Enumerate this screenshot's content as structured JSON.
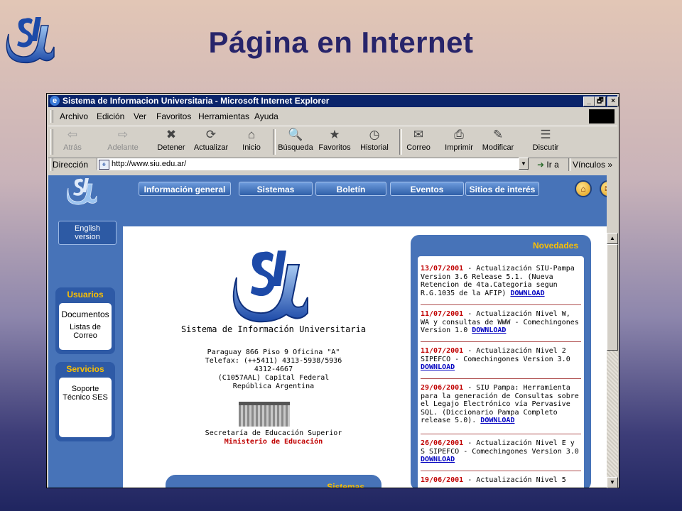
{
  "slide": {
    "title": "Página en Internet",
    "logo_text": "SIU"
  },
  "window": {
    "title": "Sistema de Informacion Universitaria - Microsoft Internet Explorer",
    "minimize": "_",
    "maximize": "🗗",
    "close": "×",
    "menu": [
      "Archivo",
      "Edición",
      "Ver",
      "Favoritos",
      "Herramientas",
      "Ayuda"
    ],
    "toolbar": [
      {
        "label": "Atrás",
        "icon": "arrow-left-icon",
        "glyph": "⇦"
      },
      {
        "label": "Adelante",
        "icon": "arrow-right-icon",
        "glyph": "⇨"
      },
      {
        "label": "Detener",
        "icon": "stop-icon",
        "glyph": "✖"
      },
      {
        "label": "Actualizar",
        "icon": "refresh-icon",
        "glyph": "⟳"
      },
      {
        "label": "Inicio",
        "icon": "home-icon",
        "glyph": "⌂"
      },
      {
        "label": "Búsqueda",
        "icon": "search-icon",
        "glyph": "🔍"
      },
      {
        "label": "Favoritos",
        "icon": "favorites-icon",
        "glyph": "★"
      },
      {
        "label": "Historial",
        "icon": "history-icon",
        "glyph": "◷"
      },
      {
        "label": "Correo",
        "icon": "mail-icon",
        "glyph": "✉"
      },
      {
        "label": "Imprimir",
        "icon": "print-icon",
        "glyph": "⎙"
      },
      {
        "label": "Modificar",
        "icon": "edit-icon",
        "glyph": "✎"
      },
      {
        "label": "Discutir",
        "icon": "discuss-icon",
        "glyph": "☰"
      }
    ],
    "address_label": "Dirección",
    "url": "http://www.siu.edu.ar/",
    "go_label": "Ir a",
    "links_label": "Vínculos"
  },
  "site": {
    "nav": [
      "Información general",
      "Sistemas",
      "Boletín",
      "Eventos",
      "Sitios de interés"
    ],
    "english_line1": "English",
    "english_line2": "version",
    "usuarios": {
      "header": "Usuarios",
      "items": [
        "Documentos",
        "Listas de",
        "Correo"
      ]
    },
    "servicios": {
      "header": "Servicios",
      "items": [
        "Soporte",
        "Técnico SES"
      ]
    },
    "center": {
      "name": "Sistema de Información Universitaria",
      "address": [
        "Paraguay 866 Piso 9 Oficina \"A\"",
        "Telefax: (++5411) 4313-5938/5936",
        "4312-4667",
        "(C1057AAL) Capital Federal",
        "República Argentina"
      ],
      "secretaria": "Secretaría de Educación Superior",
      "ministerio": "Ministerio de Educación"
    },
    "sistemas_header": "Sistemas",
    "novedades": {
      "header": "Novedades",
      "items": [
        {
          "date": "13/07/2001",
          "text": " - Actualización SIU-Pampa Version 3.6 Release 5.1. (Nueva Retencion de 4ta.Categoria segun R.G.1035 de la AFIP) ",
          "link": "DOWNLOAD"
        },
        {
          "date": "11/07/2001",
          "text": " - Actualización Nivel W, WA y consultas de WWW - Comechingones Version 1.0 ",
          "link": "DOWNLOAD"
        },
        {
          "date": "11/07/2001",
          "text": " - Actualización Nivel 2 SIPEFCO - Comechingones Version 3.0 ",
          "link": "DOWNLOAD"
        },
        {
          "date": "29/06/2001",
          "text": " - SIU Pampa: Herramienta para la generación de Consultas sobre el Legajo Electrónico vía Pervasive SQL. (Diccionario Pampa Completo release 5.0). ",
          "link": "DOWNLOAD"
        },
        {
          "date": "26/06/2001",
          "text": " - Actualización Nivel E y S SIPEFCO - Comechingones Version 3.0 ",
          "link": "DOWNLOAD"
        },
        {
          "date": "19/06/2001",
          "text": " - Actualización Nivel 5",
          "link": ""
        }
      ]
    }
  },
  "colors": {
    "site_blue": "#4773b8",
    "accent_yellow": "#fcc000",
    "date_red": "#c00000",
    "title_bar": "#0a246a"
  }
}
